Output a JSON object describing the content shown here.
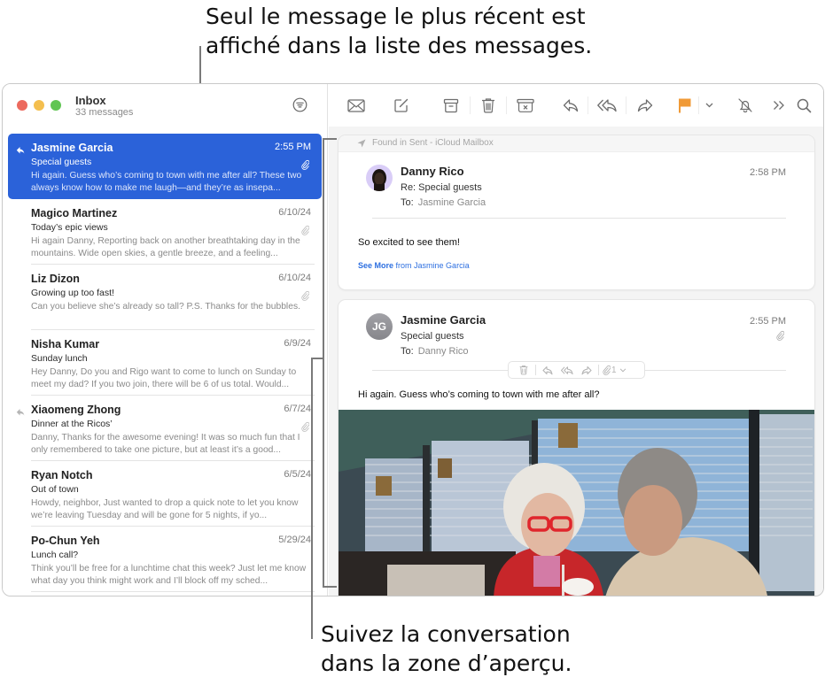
{
  "callouts": {
    "top_line1": "Seul le message le plus récent est",
    "top_line2": "affiché dans la liste des messages.",
    "bottom_line1": "Suivez la conversation",
    "bottom_line2": "dans la zone d’aperçu."
  },
  "mailbox": {
    "title": "Inbox",
    "count": "33 messages"
  },
  "toolbar": {
    "icons": [
      "envelope-icon",
      "compose-icon",
      "archive-icon",
      "trash-icon",
      "junk-icon",
      "reply-icon",
      "reply-all-icon",
      "forward-icon",
      "flag-icon",
      "flag-menu-chevron-icon",
      "mute-icon",
      "more-icon",
      "search-icon"
    ],
    "flag_color": "#f09a37"
  },
  "messages": [
    {
      "from": "Jasmine Garcia",
      "date": "2:55 PM",
      "subject": "Special guests",
      "preview": "Hi again. Guess who’s coming to town with me after all? These two always know how to make me laugh—and they’re as insepa...",
      "replied": true,
      "attachment": true,
      "selected": true
    },
    {
      "from": "Magico Martinez",
      "date": "6/10/24",
      "subject": "Today’s epic views",
      "preview": "Hi again Danny, Reporting back on another breathtaking day in the mountains. Wide open skies, a gentle breeze, and a feeling...",
      "replied": false,
      "attachment": true,
      "selected": false
    },
    {
      "from": "Liz Dizon",
      "date": "6/10/24",
      "subject": "Growing up too fast!",
      "preview": "Can you believe she’s already so tall? P.S. Thanks for the bubbles.",
      "replied": false,
      "attachment": true,
      "selected": false
    },
    {
      "from": "Nisha Kumar",
      "date": "6/9/24",
      "subject": "Sunday lunch",
      "preview": "Hey Danny, Do you and Rigo want to come to lunch on Sunday to meet my dad? If you two join, there will be 6 of us total. Would...",
      "replied": false,
      "attachment": false,
      "selected": false
    },
    {
      "from": "Xiaomeng Zhong",
      "date": "6/7/24",
      "subject": "Dinner at the Ricos’",
      "preview": "Danny, Thanks for the awesome evening! It was so much fun that I only remembered to take one picture, but at least it’s a good...",
      "replied": true,
      "attachment": true,
      "selected": false
    },
    {
      "from": "Ryan Notch",
      "date": "6/5/24",
      "subject": "Out of town",
      "preview": "Howdy, neighbor, Just wanted to drop a quick note to let you know we’re leaving Tuesday and will be gone for 5 nights, if yo...",
      "replied": false,
      "attachment": false,
      "selected": false
    },
    {
      "from": "Po-Chun Yeh",
      "date": "5/29/24",
      "subject": "Lunch call?",
      "preview": "Think you’ll be free for a lunchtime chat this week? Just let me know what day you think might work and I’ll block off my sched...",
      "replied": false,
      "attachment": false,
      "selected": false
    }
  ],
  "conversation": {
    "found_in": "Found in Sent - iCloud Mailbox",
    "reply": {
      "from": "Danny Rico",
      "subject": "Re: Special guests",
      "to_label": "To:",
      "to": "Jasmine Garcia",
      "time": "2:58 PM",
      "body": "So excited to see them!",
      "see_more": "See More",
      "see_more_suffix": "from Jasmine Garcia"
    },
    "original": {
      "initials": "JG",
      "from": "Jasmine Garcia",
      "subject": "Special guests",
      "to_label": "To:",
      "to": "Danny Rico",
      "time": "2:55 PM",
      "body": "Hi again. Guess who’s coming to town with me after all?",
      "attachment_count": "1",
      "photo_alt": "Photo of an older couple sharing a milkshake in a diner"
    }
  },
  "colors": {
    "selection": "#2b62d9",
    "link": "#2d6fe0",
    "flag": "#f09a37"
  }
}
